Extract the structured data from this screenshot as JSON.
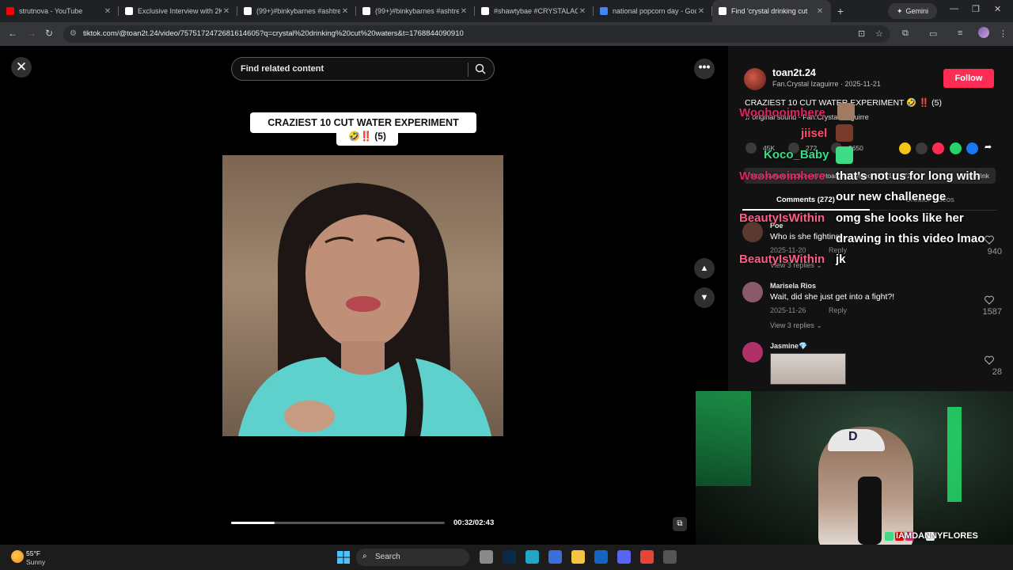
{
  "browser": {
    "tabs": [
      {
        "title": "strutnova - YouTube",
        "favicon": "youtube-icon",
        "color": "#ff0000"
      },
      {
        "title": "Exclusive Interview with 2K a",
        "favicon": "tiktok-icon",
        "color": "#ffffff"
      },
      {
        "title": "(99+)#binkybarnes #ashtrevi",
        "favicon": "tiktok-icon",
        "color": "#ffffff"
      },
      {
        "title": "(99+)#binkybarnes #ashtrevi",
        "favicon": "tiktok-icon",
        "color": "#ffffff"
      },
      {
        "title": "#shawtybae #CRYSTALACTIC",
        "favicon": "tiktok-icon",
        "color": "#ffffff"
      },
      {
        "title": "national popcorn day - Goog",
        "favicon": "google-icon",
        "color": "#4285f4"
      },
      {
        "title": "Find 'crystal drinking cut",
        "favicon": "tiktok-icon",
        "color": "#ffffff",
        "active": true
      }
    ],
    "new_tab": "+",
    "gemini_label": "Gemini",
    "url": "tiktok.com/@toan2t.24/video/7575172472681614605?q=crystal%20drinking%20cut%20waters&t=1768844090910"
  },
  "player": {
    "close_label": "✕",
    "search_placeholder": "Find related content",
    "caption_line1": "CRAZIEST 10 CUT WATER EXPERIMENT",
    "caption_line2": "🤣‼️ (5)",
    "progress_fraction": 0.203,
    "time": "00:32/02:43",
    "more_label": "•••",
    "up_label": "▲",
    "down_label": "▼"
  },
  "post": {
    "username": "toan2t.24",
    "subline": "Fan.Crystal Izaguirre · 2025-11-21",
    "follow_label": "Follow",
    "description": "CRAZIEST 10 CUT WATER EXPERIMENT 🤣 ‼️ (5)",
    "sound": "♫ original sound - Fan.Crystal Izaguirre",
    "likes": "45K",
    "comments": "272",
    "saves": "2650",
    "link": "https://www.tiktok.com/@toan2t.24/video/7575172472...",
    "copy_label": "Copy link",
    "comments_tab": "Comments (272)",
    "creator_tab": "Creator videos",
    "share_colors": [
      "#f5c518",
      "#555555",
      "#fe2c55",
      "#25d366",
      "#1877f2"
    ]
  },
  "comments": [
    {
      "name": "Poe",
      "text": "Who is she fighting",
      "date": "2025-11-20",
      "reply": "Reply",
      "view_replies": "View 3 replies ⌄",
      "likes": "940",
      "avatar_color": "#5a3a30"
    },
    {
      "name": "Marisela Rios",
      "text": "Wait, did she just get into a fight?!",
      "date": "2025-11-26",
      "reply": "Reply",
      "view_replies": "View 3 replies ⌄",
      "likes": "1587",
      "avatar_color": "#8a5a6a"
    },
    {
      "name": "Jasmine💎",
      "text": "",
      "date": "",
      "reply": "",
      "view_replies": "",
      "likes": "28",
      "avatar_color": "#b0306a"
    }
  ],
  "chat": [
    {
      "name": "Woohooimhere",
      "msg": "",
      "name_color": "#e0245e"
    },
    {
      "name": "jiisel",
      "msg": "",
      "name_color": "#ff4d6d"
    },
    {
      "name": "Koco_Baby",
      "msg": "",
      "name_color": "#3ddc84"
    },
    {
      "name": "Woohooimhere",
      "msg": "that's not us for long with",
      "name_color": "#e0245e"
    },
    {
      "name": "",
      "msg": "our new challenege",
      "name_color": "#ffffff"
    },
    {
      "name": "BeautyIsWithin",
      "msg": "omg she looks like her",
      "name_color": "#ff5c8a"
    },
    {
      "name": "",
      "msg": "drawing in this video lmao",
      "name_color": "#ffffff"
    },
    {
      "name": "BeautyIsWithin",
      "msg": "jk",
      "name_color": "#ff5c8a"
    }
  ],
  "webcam": {
    "handle": "IAMDANNYFLORES",
    "hat_logo": "D",
    "social_colors": [
      "#3ddc84",
      "#ff0000",
      "#e1306c",
      "#111111",
      "#ffffff"
    ]
  },
  "taskbar": {
    "temp": "55°F",
    "condition": "Sunny",
    "search_label": "Search",
    "apps": [
      {
        "name": "file-explorer-icon",
        "color": "#8a8a8a"
      },
      {
        "name": "photoshop-icon",
        "color": "#0a2a4a"
      },
      {
        "name": "edge-icon",
        "color": "#1fa6c9"
      },
      {
        "name": "store-icon",
        "color": "#3a6fd8"
      },
      {
        "name": "folder-icon",
        "color": "#f5c542"
      },
      {
        "name": "outlook-icon",
        "color": "#1565c0"
      },
      {
        "name": "discord-icon",
        "color": "#5865f2"
      },
      {
        "name": "chrome-icon",
        "color": "#ea4335"
      },
      {
        "name": "obs-icon",
        "color": "#555555"
      }
    ]
  }
}
